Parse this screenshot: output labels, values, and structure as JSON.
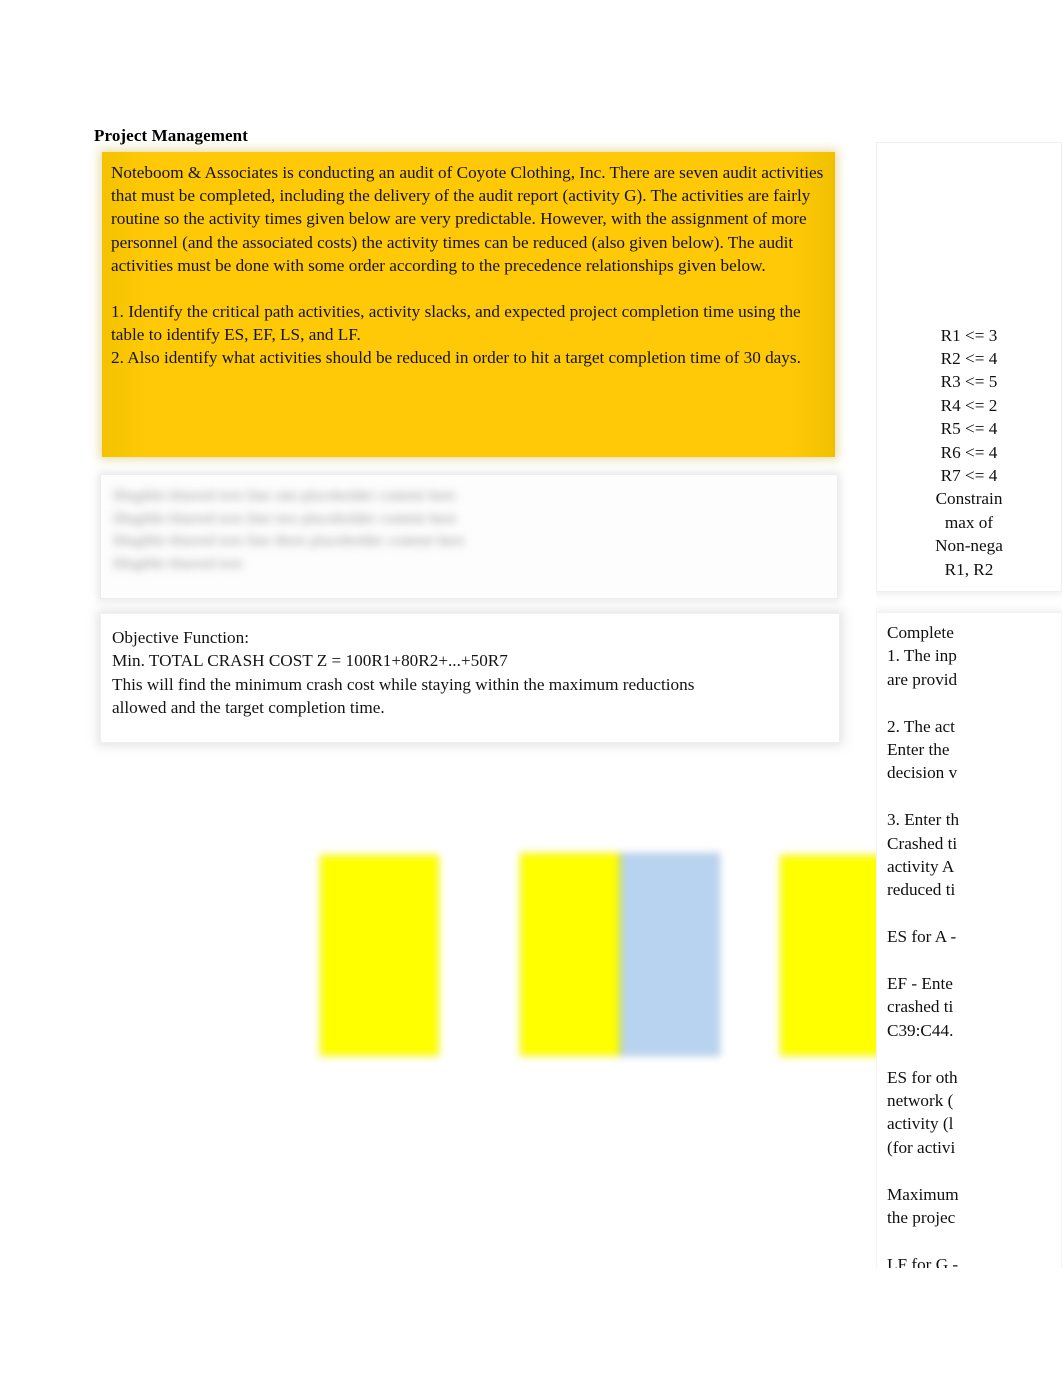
{
  "document": {
    "title": "Project Management"
  },
  "prompt_box": {
    "accent_color": "#FFC907",
    "scenario_paragraph": "Noteboom & Associates is conducting an audit of Coyote Clothing, Inc.  There are seven audit activities that must be completed, including the delivery of the audit report (activity G).  The activities are fairly routine so the activity times given below are very predictable.  However, with the assignment of more personnel (and the associated costs) the activity times can be reduced (also given below).  The audit activities must be done with some order according to the precedence relationships given below.",
    "task_1": "1.  Identify the critical path activities, activity slacks, and expected project completion time using the table to identify ES, EF, LS, and LF.",
    "task_2": "2.  Also identify what activities should be reduced in order to hit a target completion time of 30 days."
  },
  "blurred_note_box": {
    "legible": false,
    "lines": [
      "Illegible blurred text line one placeholder content here",
      "Illegible blurred text line two placeholder content here",
      "Illegible blurred text line three placeholder content here",
      "Illegible blurred text"
    ]
  },
  "objective_box": {
    "heading": "Objective Function:",
    "formula": "Min. TOTAL CRASH COST  Z = 100R1+80R2+...+50R7",
    "explanation_line_1": "This will find the minimum crash cost while staying within the maximum reductions",
    "explanation_line_2": "allowed and the target completion time."
  },
  "cells": {
    "yellow_color": "#FFFF00",
    "blue_color": "#B8D3EF",
    "blocks": [
      {
        "name": "yellow-cell-left",
        "fill": "#FFFF00",
        "value": ""
      },
      {
        "name": "yellow-cell-middle",
        "fill": "#FFFF00",
        "value": ""
      },
      {
        "name": "blue-cell-middle",
        "fill": "#B8D3EF",
        "value": ""
      },
      {
        "name": "yellow-cell-right",
        "fill": "#FFFF00",
        "value": ""
      }
    ]
  },
  "constraints_panel": {
    "lines": [
      "R1 <= 3",
      "R2 <= 4",
      "R3 <= 5",
      "R4 <= 2",
      "R5 <= 4",
      "R6 <= 4",
      "R7 <= 4",
      "Constrain",
      "max of",
      "Non-nega",
      "R1, R2"
    ]
  },
  "instructions_panel": {
    "lines": [
      "Complete",
      "1. The inp",
      "are provid",
      "",
      "2. The act",
      "Enter the",
      "decision v",
      "",
      "3. Enter th",
      "Crashed ti",
      "activity A",
      "reduced ti",
      "",
      "ES for A -",
      "",
      "EF - Ente",
      "crashed ti",
      "C39:C44.",
      "",
      "ES for oth",
      "network (",
      "activity (l",
      "(for activi",
      "",
      "Maximum",
      "the projec",
      "",
      "LF for G -"
    ]
  }
}
